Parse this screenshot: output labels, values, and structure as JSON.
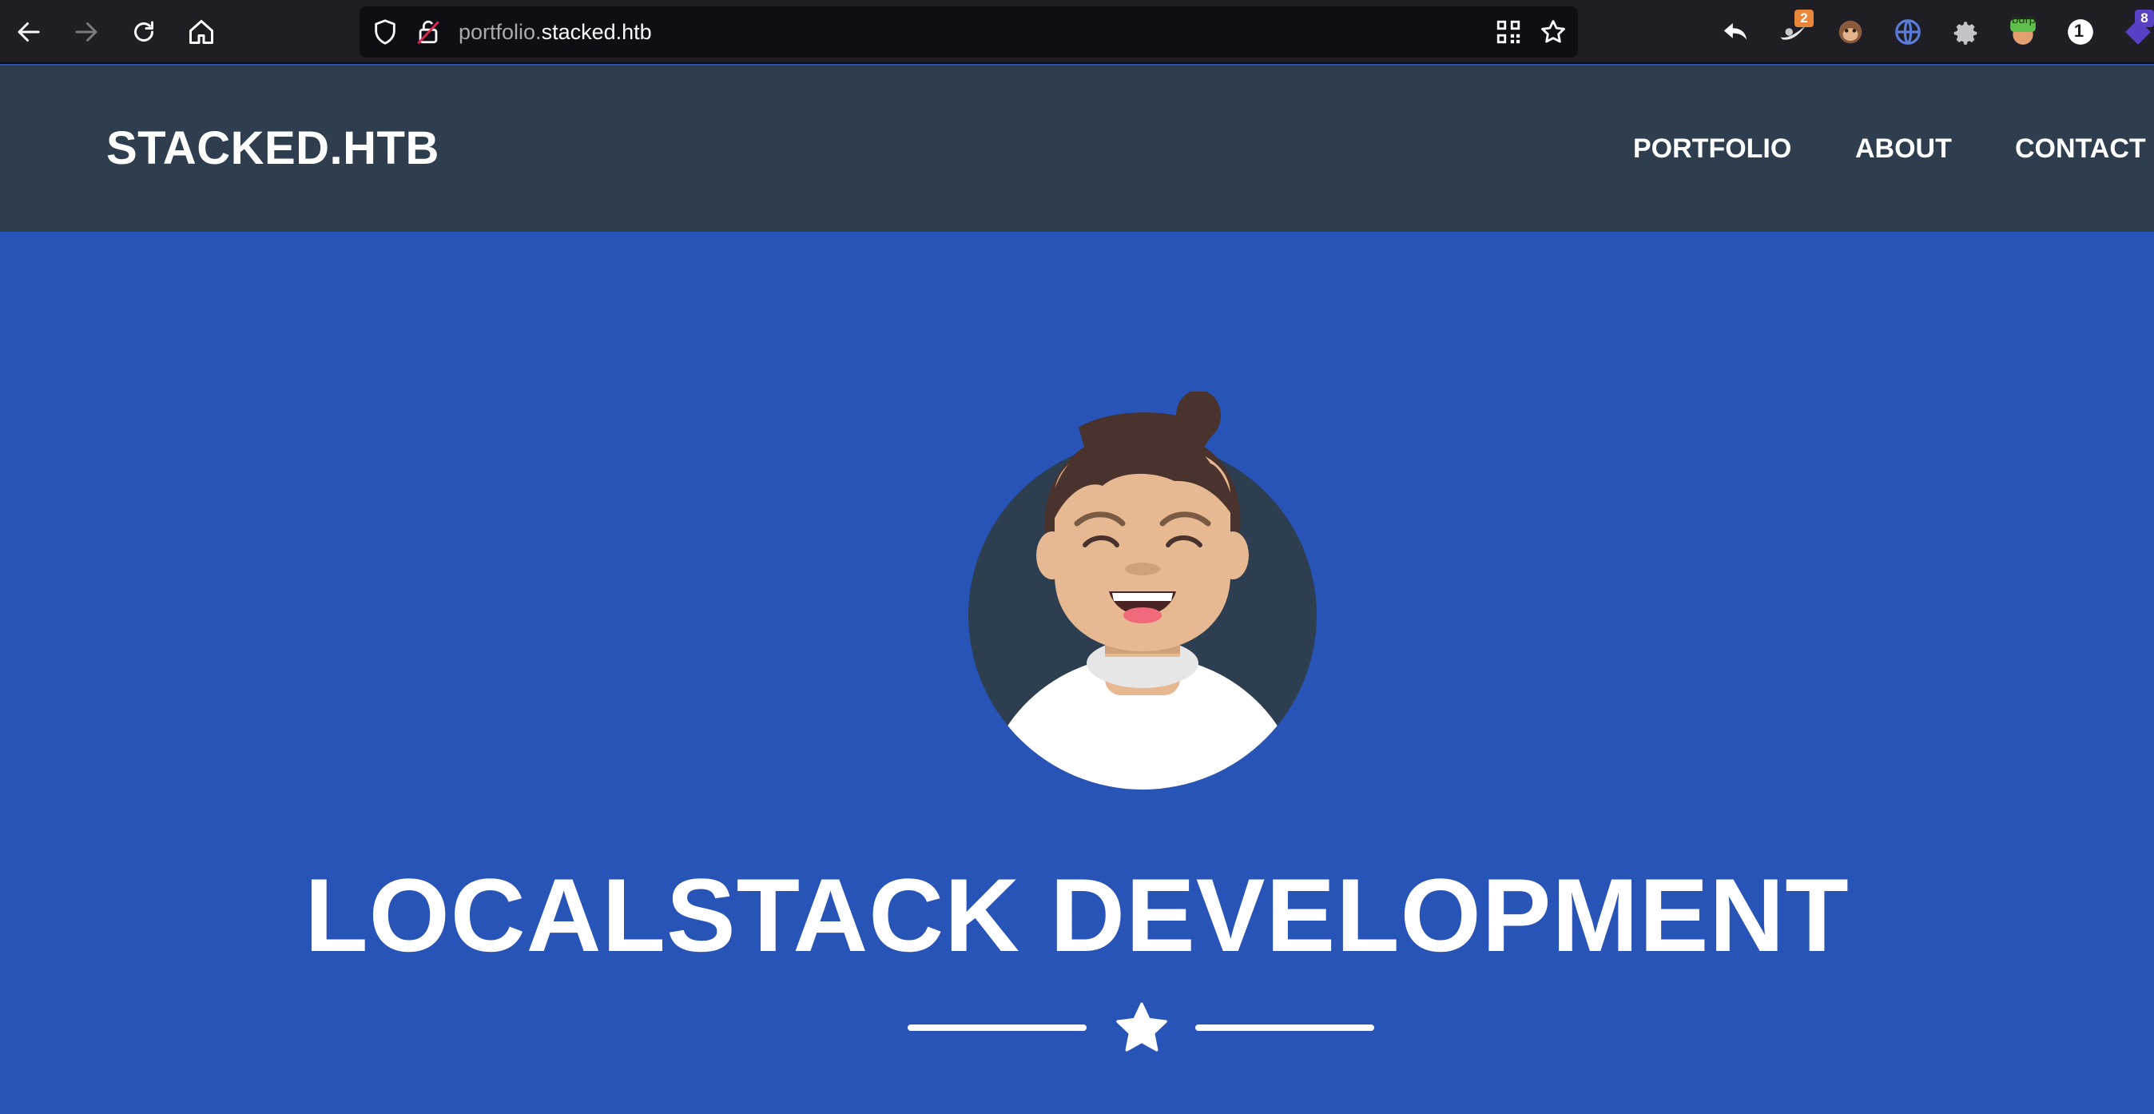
{
  "browser": {
    "url_prefix": "portfolio.",
    "url_host": "stacked.htb",
    "extension_badges": {
      "ext2": "2",
      "onepassword": "1",
      "ext_last": "8"
    },
    "extension_labels": {
      "burp": "burp"
    }
  },
  "site": {
    "brand": "STACKED.HTB",
    "nav": [
      "PORTFOLIO",
      "ABOUT",
      "CONTACT"
    ]
  },
  "masthead": {
    "headline": "LOCALSTACK DEVELOPMENT"
  },
  "colors": {
    "chrome": "#1f1e24",
    "navbar": "#2e3e4f",
    "masthead": "#2854b7",
    "text": "#ffffff"
  }
}
